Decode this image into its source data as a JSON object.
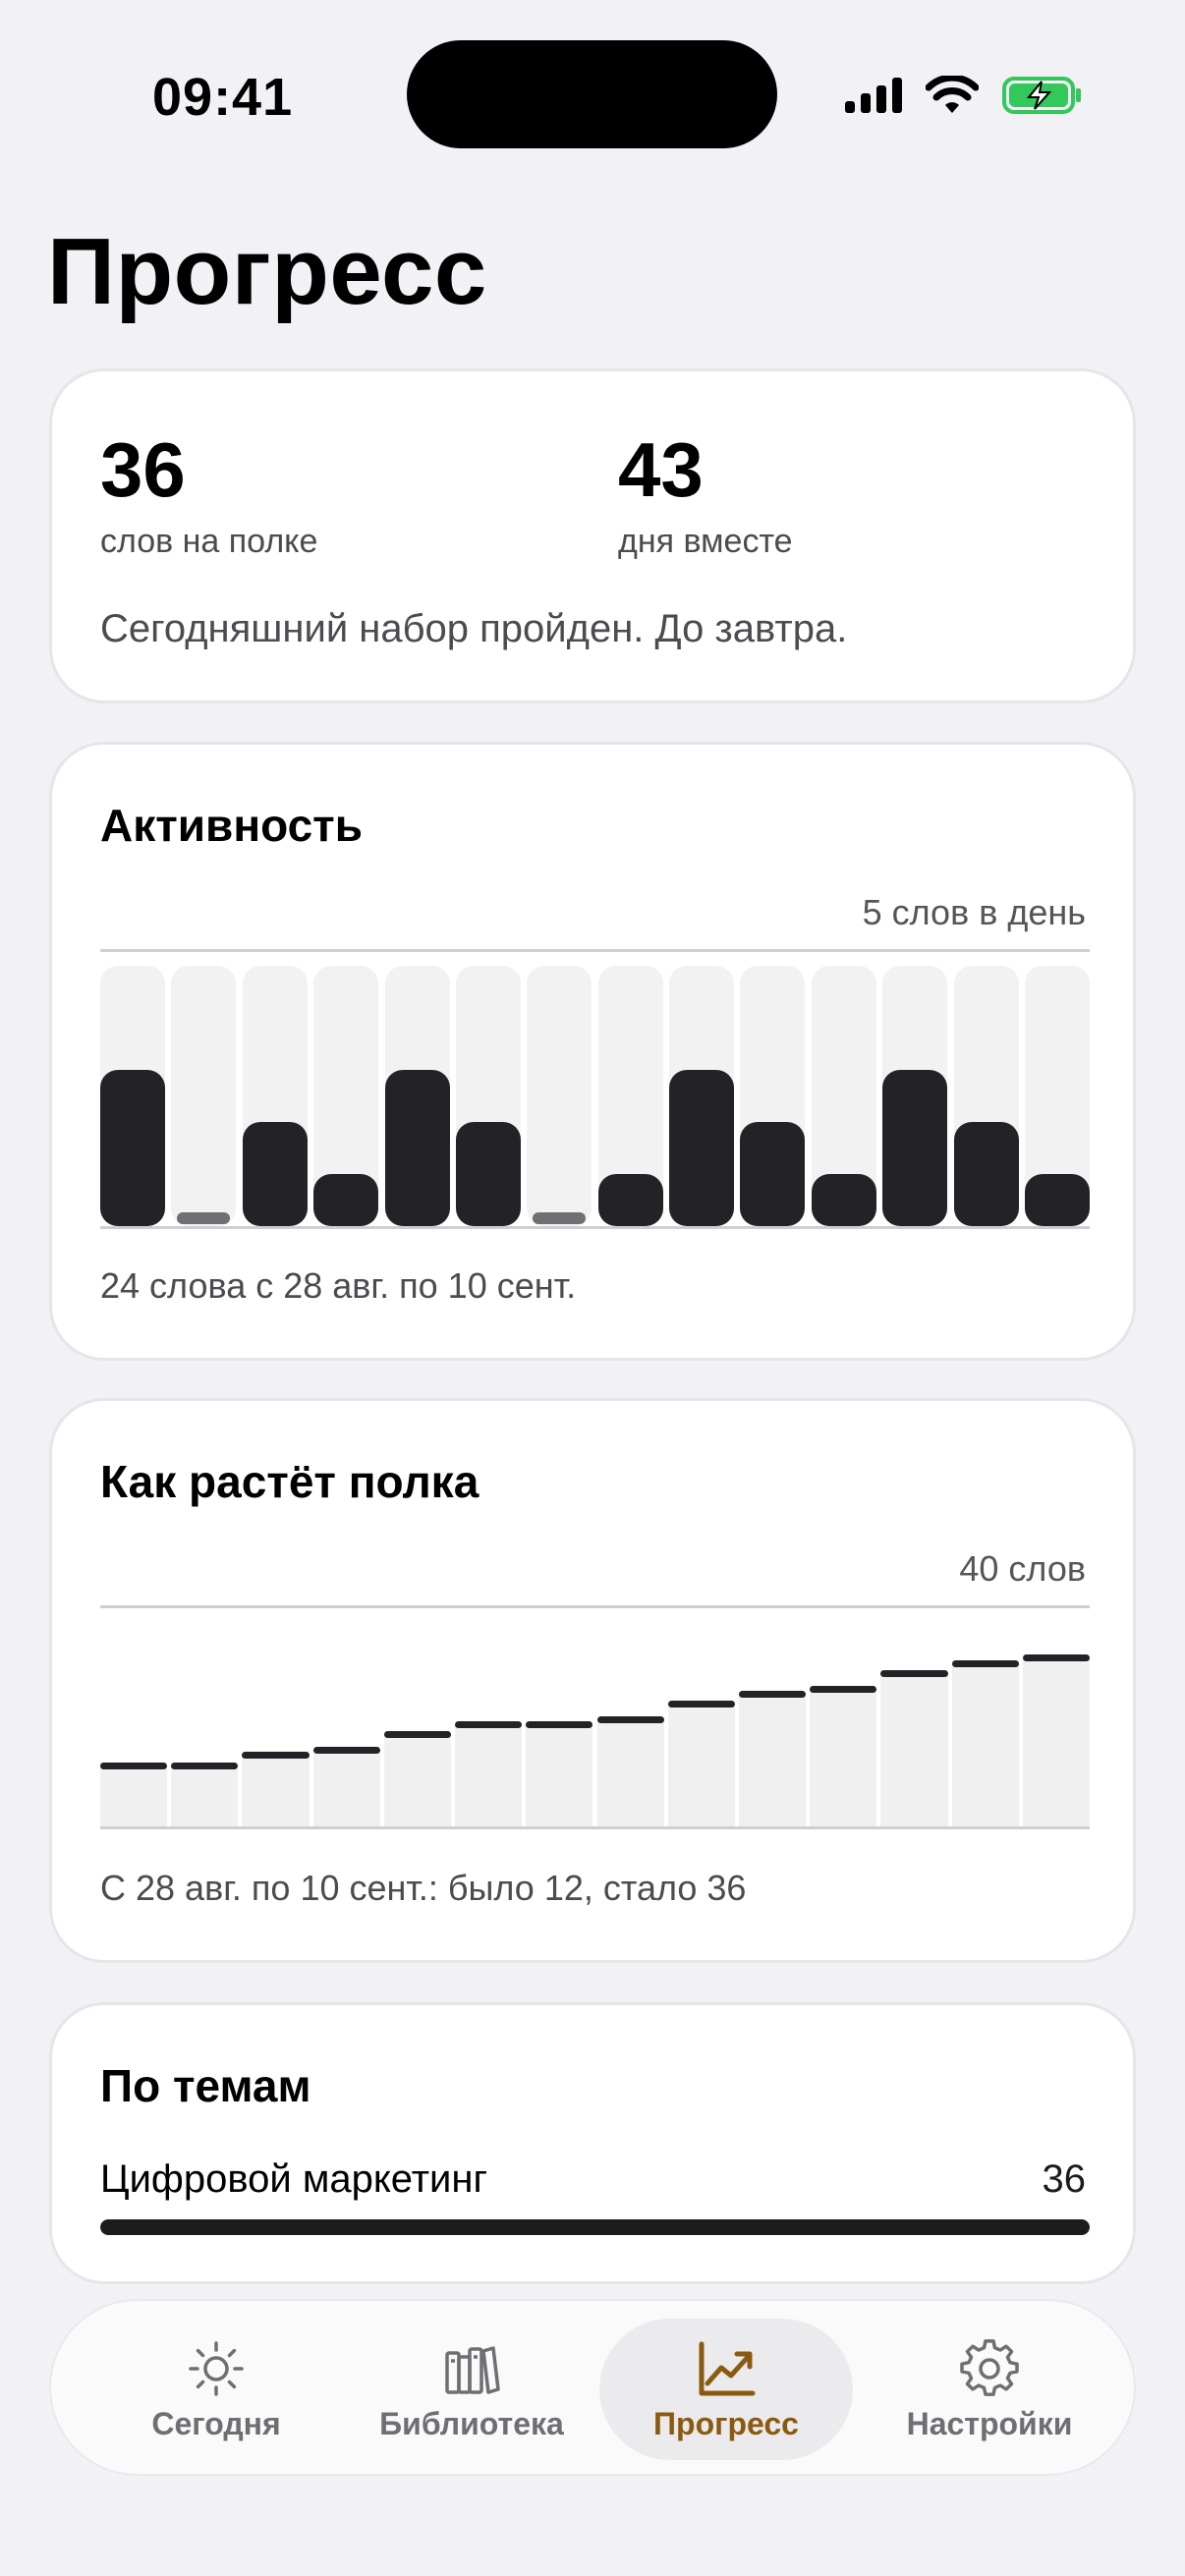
{
  "status_bar": {
    "time": "09:41"
  },
  "page": {
    "title": "Прогресс"
  },
  "summary": {
    "words_count": "36",
    "words_label": "слов на полке",
    "days_count": "43",
    "days_label": "дня вместе",
    "message": "Сегодняшний набор пройден. До завтра."
  },
  "activity": {
    "title": "Активность",
    "max_label": "5 слов в день",
    "caption": "24 слова с 28 авг. по 10 сент."
  },
  "growth": {
    "title": "Как растёт полка",
    "max_label": "40 слов",
    "caption": "С 28 авг. по 10 сент.: было 12, стало 36"
  },
  "topics": {
    "title": "По темам",
    "items": [
      {
        "name": "Цифровой маркетинг",
        "count": "36",
        "fraction": 1.0
      }
    ]
  },
  "tabs": [
    {
      "label": "Сегодня",
      "icon": "sun-icon",
      "active": false
    },
    {
      "label": "Библиотека",
      "icon": "books-icon",
      "active": false
    },
    {
      "label": "Прогресс",
      "icon": "chart-icon",
      "active": true
    },
    {
      "label": "Настройки",
      "icon": "gear-icon",
      "active": false
    }
  ],
  "colors": {
    "accent": "#8b5a10",
    "bar": "#232327",
    "background": "#f2f1f6"
  },
  "chart_data": [
    {
      "type": "bar",
      "title": "Активность",
      "ylabel": "",
      "ylim": [
        0,
        5
      ],
      "max_label": "5 слов в день",
      "series": [
        {
          "values": [
            3,
            0,
            2,
            1,
            3,
            2,
            0,
            1,
            3,
            2,
            1,
            3,
            2,
            1
          ]
        }
      ]
    },
    {
      "type": "bar",
      "title": "Как растёт полка",
      "ylabel": "",
      "ylim": [
        0,
        40
      ],
      "max_label": "40 слов",
      "series": [
        {
          "values": [
            12,
            12,
            14,
            15,
            18,
            20,
            20,
            21,
            24,
            26,
            27,
            30,
            32,
            33
          ]
        }
      ]
    }
  ]
}
